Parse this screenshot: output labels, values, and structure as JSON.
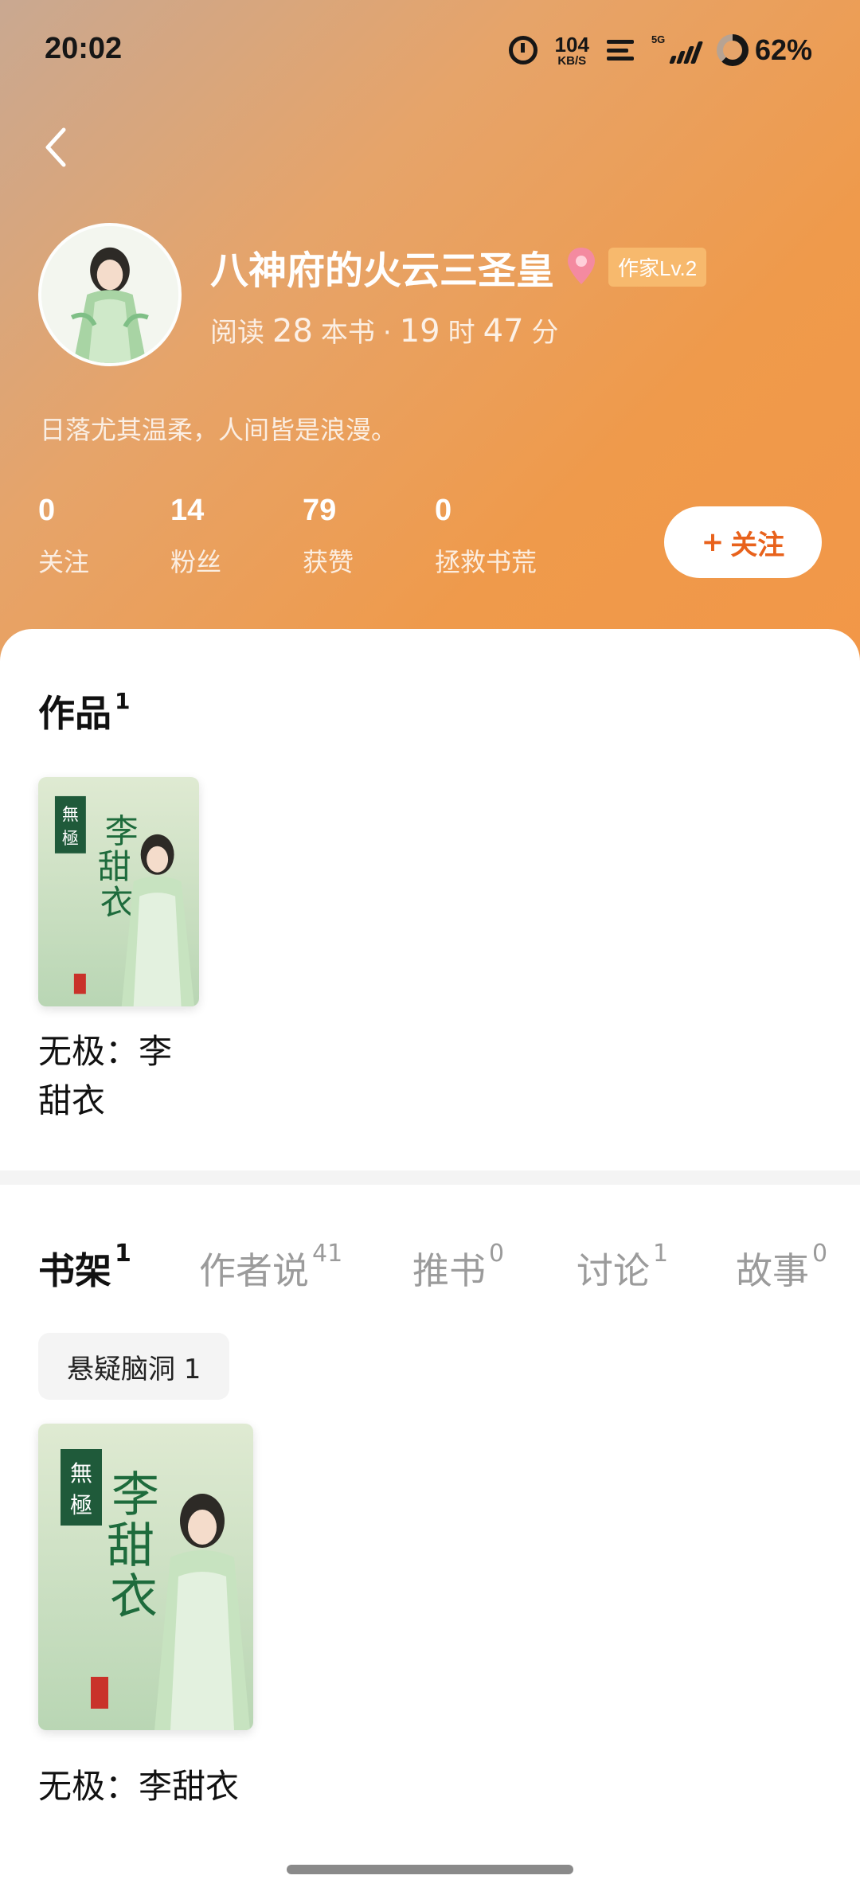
{
  "status_bar": {
    "time": "20:02",
    "net_speed": "104",
    "net_unit": "KB/S",
    "network_tag": "5G",
    "battery": "62%"
  },
  "profile": {
    "name": "八神府的火云三圣皇",
    "level": "作家Lv.2",
    "reading": {
      "prefix": "阅读",
      "books": "28",
      "books_unit": "本书",
      "sep": "·",
      "hours": "19",
      "hours_unit": "时",
      "minutes": "47",
      "minutes_unit": "分"
    },
    "bio": "日落尤其温柔，人间皆是浪漫。"
  },
  "stats": [
    {
      "count": "0",
      "label": "关注"
    },
    {
      "count": "14",
      "label": "粉丝"
    },
    {
      "count": "79",
      "label": "获赞"
    },
    {
      "count": "0",
      "label": "拯救书荒"
    }
  ],
  "follow_button": {
    "label": "关注",
    "icon": "+"
  },
  "works": {
    "title": "作品",
    "count": "1",
    "items": [
      {
        "title": "无极：李甜衣"
      }
    ]
  },
  "cover": {
    "seal_top": "無",
    "seal_bottom": "極",
    "calligraphy": [
      "李",
      "甜",
      "衣"
    ]
  },
  "bookshelf": {
    "tabs": [
      {
        "label": "书架",
        "count": "1"
      },
      {
        "label": "作者说",
        "count": "41"
      },
      {
        "label": "推书",
        "count": "0"
      },
      {
        "label": "讨论",
        "count": "1"
      },
      {
        "label": "故事",
        "count": "0"
      }
    ],
    "chip": "悬疑脑洞 1",
    "items": [
      {
        "title": "无极：李甜衣"
      }
    ]
  },
  "colors": {
    "header_start": "#c9a891",
    "header_end": "#f29748",
    "accent": "#e8621c",
    "badge": "#f7b96d"
  }
}
